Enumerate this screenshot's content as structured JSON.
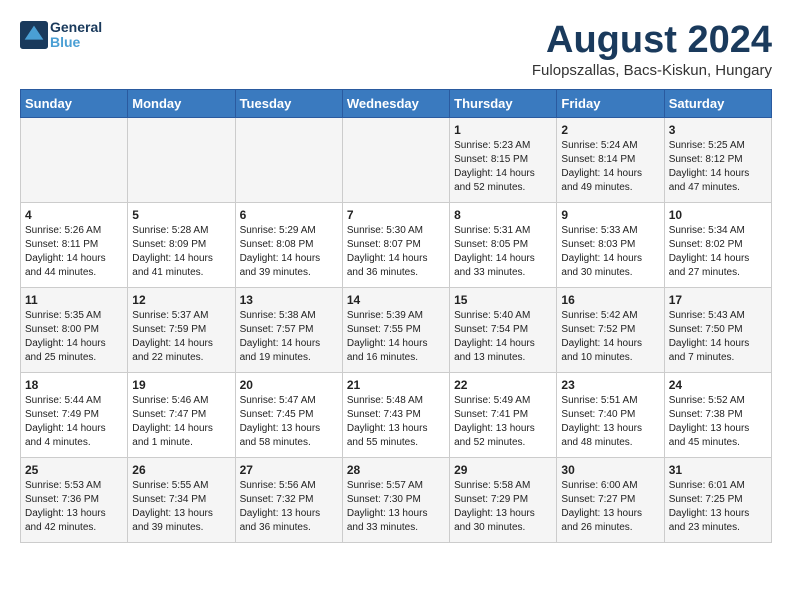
{
  "header": {
    "logo_general": "General",
    "logo_blue": "Blue",
    "month_year": "August 2024",
    "location": "Fulopszallas, Bacs-Kiskun, Hungary"
  },
  "weekdays": [
    "Sunday",
    "Monday",
    "Tuesday",
    "Wednesday",
    "Thursday",
    "Friday",
    "Saturday"
  ],
  "weeks": [
    [
      {
        "day": "",
        "info": ""
      },
      {
        "day": "",
        "info": ""
      },
      {
        "day": "",
        "info": ""
      },
      {
        "day": "",
        "info": ""
      },
      {
        "day": "1",
        "info": "Sunrise: 5:23 AM\nSunset: 8:15 PM\nDaylight: 14 hours\nand 52 minutes."
      },
      {
        "day": "2",
        "info": "Sunrise: 5:24 AM\nSunset: 8:14 PM\nDaylight: 14 hours\nand 49 minutes."
      },
      {
        "day": "3",
        "info": "Sunrise: 5:25 AM\nSunset: 8:12 PM\nDaylight: 14 hours\nand 47 minutes."
      }
    ],
    [
      {
        "day": "4",
        "info": "Sunrise: 5:26 AM\nSunset: 8:11 PM\nDaylight: 14 hours\nand 44 minutes."
      },
      {
        "day": "5",
        "info": "Sunrise: 5:28 AM\nSunset: 8:09 PM\nDaylight: 14 hours\nand 41 minutes."
      },
      {
        "day": "6",
        "info": "Sunrise: 5:29 AM\nSunset: 8:08 PM\nDaylight: 14 hours\nand 39 minutes."
      },
      {
        "day": "7",
        "info": "Sunrise: 5:30 AM\nSunset: 8:07 PM\nDaylight: 14 hours\nand 36 minutes."
      },
      {
        "day": "8",
        "info": "Sunrise: 5:31 AM\nSunset: 8:05 PM\nDaylight: 14 hours\nand 33 minutes."
      },
      {
        "day": "9",
        "info": "Sunrise: 5:33 AM\nSunset: 8:03 PM\nDaylight: 14 hours\nand 30 minutes."
      },
      {
        "day": "10",
        "info": "Sunrise: 5:34 AM\nSunset: 8:02 PM\nDaylight: 14 hours\nand 27 minutes."
      }
    ],
    [
      {
        "day": "11",
        "info": "Sunrise: 5:35 AM\nSunset: 8:00 PM\nDaylight: 14 hours\nand 25 minutes."
      },
      {
        "day": "12",
        "info": "Sunrise: 5:37 AM\nSunset: 7:59 PM\nDaylight: 14 hours\nand 22 minutes."
      },
      {
        "day": "13",
        "info": "Sunrise: 5:38 AM\nSunset: 7:57 PM\nDaylight: 14 hours\nand 19 minutes."
      },
      {
        "day": "14",
        "info": "Sunrise: 5:39 AM\nSunset: 7:55 PM\nDaylight: 14 hours\nand 16 minutes."
      },
      {
        "day": "15",
        "info": "Sunrise: 5:40 AM\nSunset: 7:54 PM\nDaylight: 14 hours\nand 13 minutes."
      },
      {
        "day": "16",
        "info": "Sunrise: 5:42 AM\nSunset: 7:52 PM\nDaylight: 14 hours\nand 10 minutes."
      },
      {
        "day": "17",
        "info": "Sunrise: 5:43 AM\nSunset: 7:50 PM\nDaylight: 14 hours\nand 7 minutes."
      }
    ],
    [
      {
        "day": "18",
        "info": "Sunrise: 5:44 AM\nSunset: 7:49 PM\nDaylight: 14 hours\nand 4 minutes."
      },
      {
        "day": "19",
        "info": "Sunrise: 5:46 AM\nSunset: 7:47 PM\nDaylight: 14 hours\nand 1 minute."
      },
      {
        "day": "20",
        "info": "Sunrise: 5:47 AM\nSunset: 7:45 PM\nDaylight: 13 hours\nand 58 minutes."
      },
      {
        "day": "21",
        "info": "Sunrise: 5:48 AM\nSunset: 7:43 PM\nDaylight: 13 hours\nand 55 minutes."
      },
      {
        "day": "22",
        "info": "Sunrise: 5:49 AM\nSunset: 7:41 PM\nDaylight: 13 hours\nand 52 minutes."
      },
      {
        "day": "23",
        "info": "Sunrise: 5:51 AM\nSunset: 7:40 PM\nDaylight: 13 hours\nand 48 minutes."
      },
      {
        "day": "24",
        "info": "Sunrise: 5:52 AM\nSunset: 7:38 PM\nDaylight: 13 hours\nand 45 minutes."
      }
    ],
    [
      {
        "day": "25",
        "info": "Sunrise: 5:53 AM\nSunset: 7:36 PM\nDaylight: 13 hours\nand 42 minutes."
      },
      {
        "day": "26",
        "info": "Sunrise: 5:55 AM\nSunset: 7:34 PM\nDaylight: 13 hours\nand 39 minutes."
      },
      {
        "day": "27",
        "info": "Sunrise: 5:56 AM\nSunset: 7:32 PM\nDaylight: 13 hours\nand 36 minutes."
      },
      {
        "day": "28",
        "info": "Sunrise: 5:57 AM\nSunset: 7:30 PM\nDaylight: 13 hours\nand 33 minutes."
      },
      {
        "day": "29",
        "info": "Sunrise: 5:58 AM\nSunset: 7:29 PM\nDaylight: 13 hours\nand 30 minutes."
      },
      {
        "day": "30",
        "info": "Sunrise: 6:00 AM\nSunset: 7:27 PM\nDaylight: 13 hours\nand 26 minutes."
      },
      {
        "day": "31",
        "info": "Sunrise: 6:01 AM\nSunset: 7:25 PM\nDaylight: 13 hours\nand 23 minutes."
      }
    ]
  ]
}
